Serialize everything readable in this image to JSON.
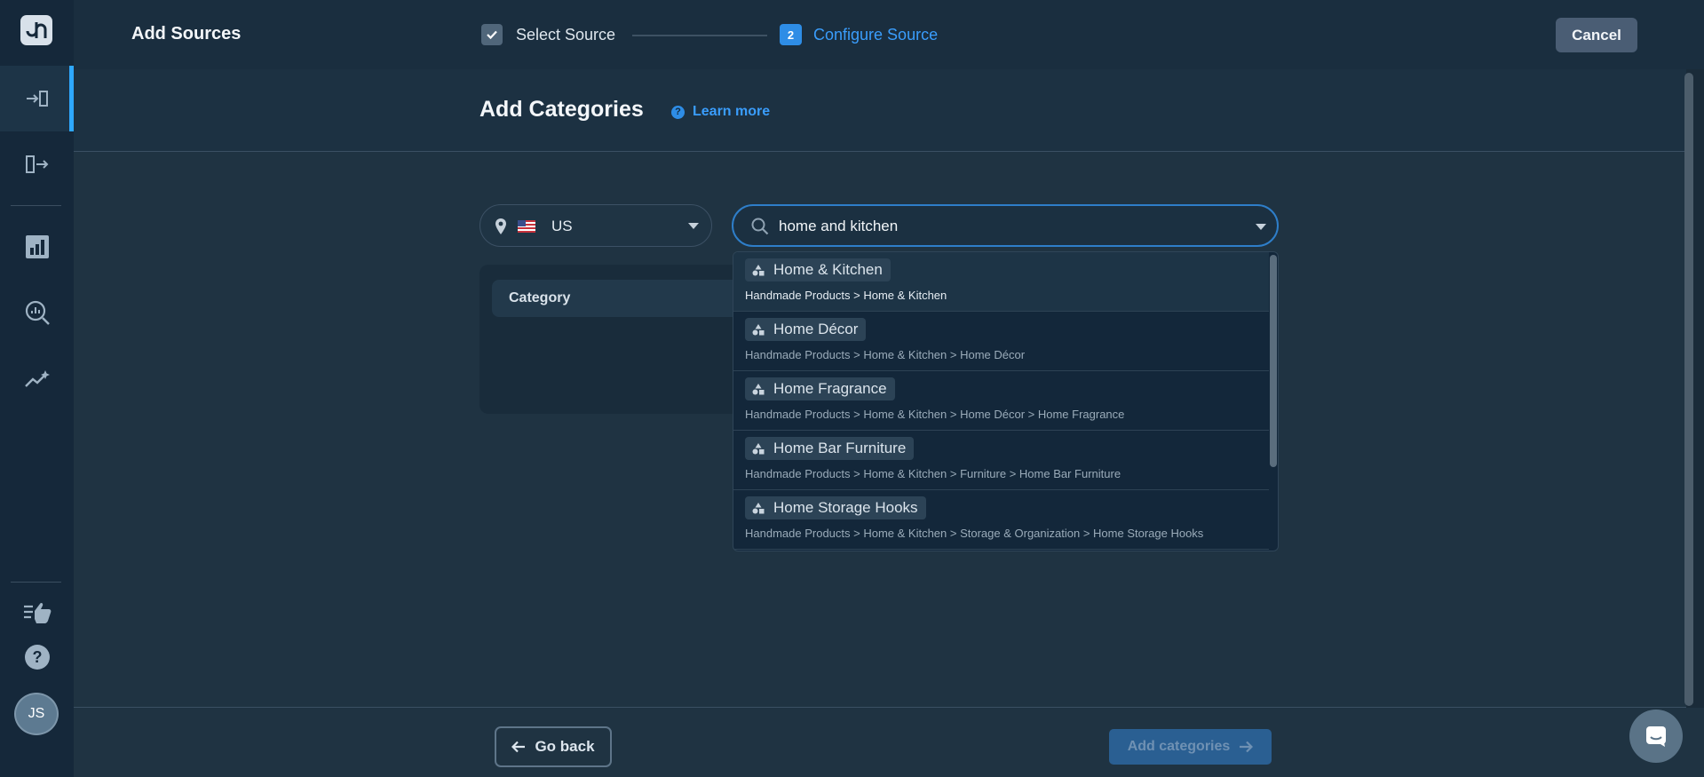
{
  "app": {
    "title": "Add Sources"
  },
  "stepper": {
    "step1": {
      "label": "Select Source"
    },
    "step2": {
      "number": "2",
      "label": "Configure Source"
    }
  },
  "header": {
    "cancel_label": "Cancel",
    "page_title": "Add Categories",
    "learn_more": "Learn more"
  },
  "sidebar": {
    "avatar_initials": "JS",
    "items": [
      {
        "icon": "import-icon",
        "active": true
      },
      {
        "icon": "export-icon",
        "active": false
      },
      {
        "icon": "bar-chart-icon",
        "active": false
      },
      {
        "icon": "search-analytics-icon",
        "active": false
      },
      {
        "icon": "trending-sparkle-icon",
        "active": false
      },
      {
        "icon": "feedback-hand-icon",
        "active": false
      },
      {
        "icon": "help-icon",
        "active": false
      }
    ]
  },
  "filters": {
    "country": "US",
    "search_value": "home and kitchen"
  },
  "table": {
    "column_header": "Category"
  },
  "dropdown": {
    "options": [
      {
        "name": "Home & Kitchen",
        "path": "Handmade Products > Home & Kitchen"
      },
      {
        "name": "Home Décor",
        "path": "Handmade Products > Home & Kitchen > Home Décor"
      },
      {
        "name": "Home Fragrance",
        "path": "Handmade Products > Home & Kitchen > Home Décor > Home Fragrance"
      },
      {
        "name": "Home Bar Furniture",
        "path": "Handmade Products > Home & Kitchen > Furniture > Home Bar Furniture"
      },
      {
        "name": "Home Storage Hooks",
        "path": "Handmade Products > Home & Kitchen > Storage & Organization > Home Storage Hooks"
      }
    ]
  },
  "footer": {
    "go_back": "Go back",
    "add_categories": "Add categories"
  },
  "colors": {
    "accent": "#3a9dfc",
    "background": "#1f3342",
    "sidebar": "#15283a"
  }
}
